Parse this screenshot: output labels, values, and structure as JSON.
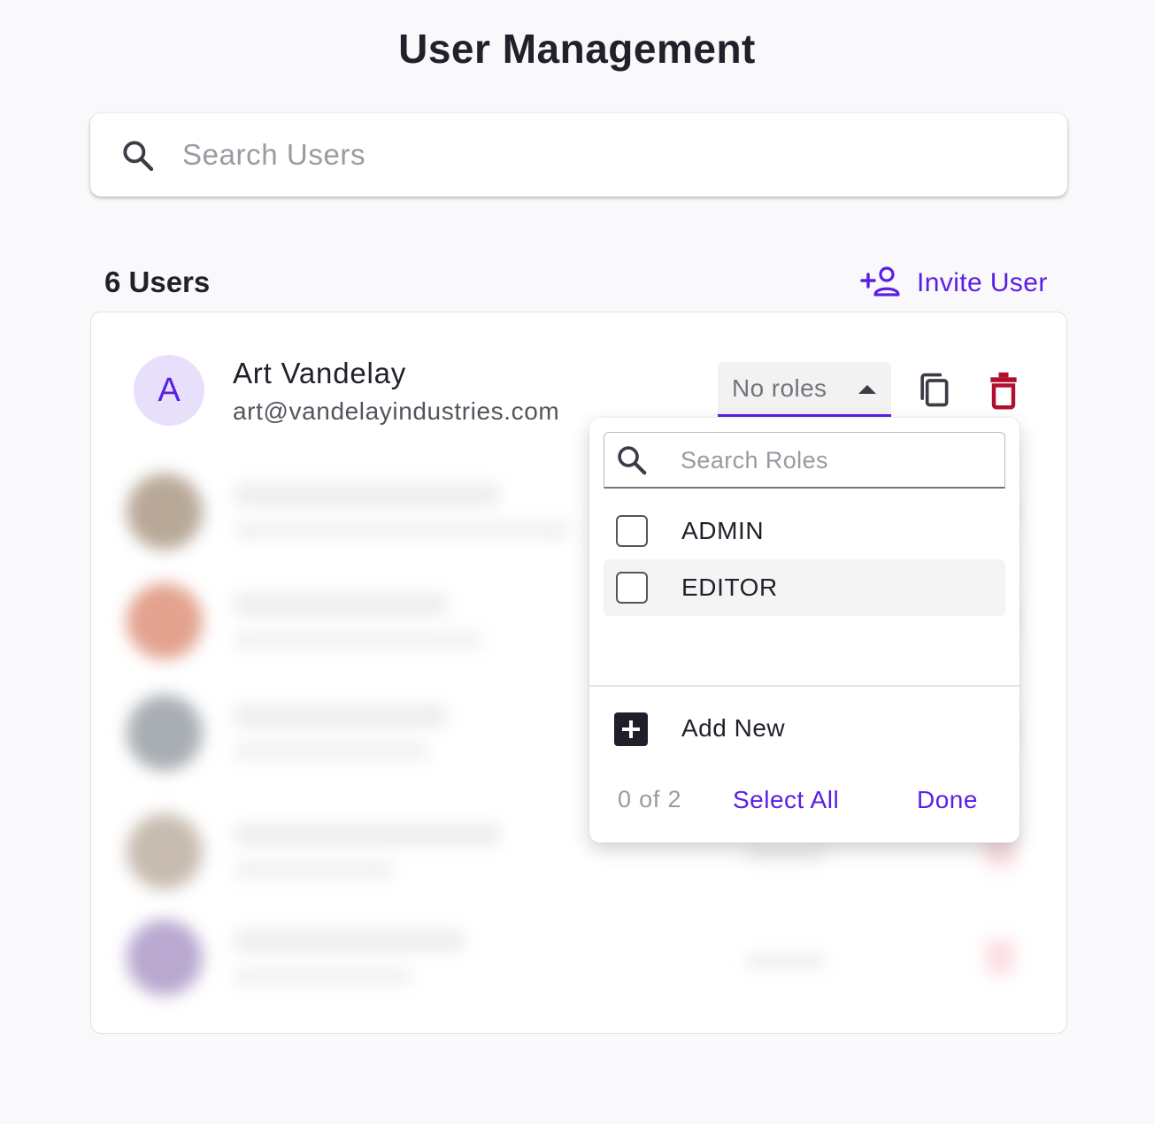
{
  "page": {
    "title": "User Management"
  },
  "search": {
    "placeholder": "Search Users",
    "icon": "search-icon"
  },
  "users": {
    "count_label": "6 Users",
    "invite_label": "Invite User",
    "invite_icon": "add-person-icon"
  },
  "current_user": {
    "initial": "A",
    "name": "Art Vandelay",
    "email": "art@vandelayindustries.com",
    "roles_label": "No roles"
  },
  "roles_dropdown": {
    "search_placeholder": "Search Roles",
    "options": [
      {
        "label": "ADMIN",
        "checked": false
      },
      {
        "label": "EDITOR",
        "checked": false
      }
    ],
    "add_new_label": "Add New",
    "selection_count": "0 of 2",
    "select_all_label": "Select All",
    "done_label": "Done"
  },
  "colors": {
    "accent": "#5b1ee6",
    "danger": "#b0102e",
    "avatar_bg": "#e8e0fb",
    "text_primary": "#22212b",
    "text_secondary": "#55545e",
    "page_bg": "#f9f9fb"
  },
  "blurred_rows": [
    {
      "avatar_color": "#b8a898"
    },
    {
      "avatar_color": "#e3a28e"
    },
    {
      "avatar_color": "#a8aeb3"
    },
    {
      "avatar_color": "#c8bcb0"
    },
    {
      "avatar_color": "#b9a8cf"
    }
  ]
}
